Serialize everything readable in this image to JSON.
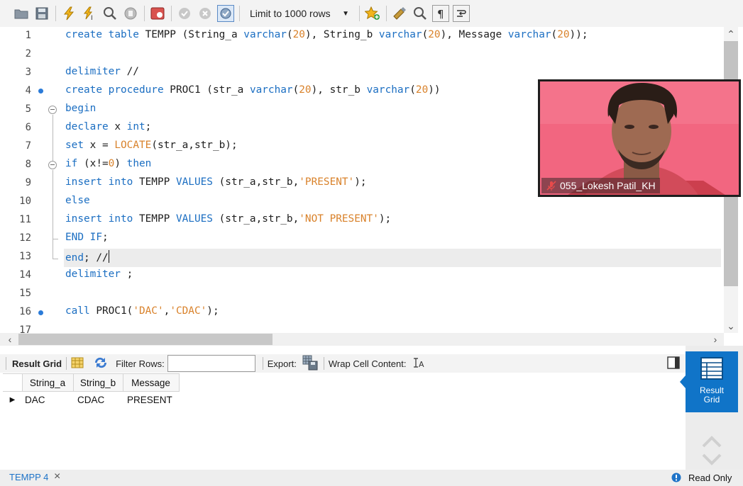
{
  "toolbar": {
    "limit_label": "Limit to 1000 rows",
    "icons": [
      "open-folder-icon",
      "save-icon",
      "execute-icon",
      "execute-cursor-icon",
      "explain-icon",
      "stop-icon",
      "toggle-error-icon",
      "commit-icon",
      "rollback-icon",
      "autocommit-icon",
      "add-snippet-icon",
      "beautify-icon",
      "find-icon",
      "invisible-chars-icon",
      "wrap-lines-icon"
    ]
  },
  "editor": {
    "line_numbers": [
      "1",
      "2",
      "3",
      "4",
      "5",
      "6",
      "7",
      "8",
      "9",
      "10",
      "11",
      "12",
      "13",
      "14",
      "15",
      "16",
      "17"
    ],
    "lines": [
      "create table TEMPP (String_a varchar(20), String_b varchar(20), Message varchar(20));",
      "",
      "delimiter //",
      "create procedure PROC1 (str_a varchar(20), str_b varchar(20))",
      "begin",
      "declare x int;",
      "set x = LOCATE(str_a,str_b);",
      "if (x!=0) then",
      "insert into TEMPP VALUES (str_a,str_b,'PRESENT');",
      "else",
      "insert into TEMPP VALUES (str_a,str_b,'NOT PRESENT');",
      "END IF;",
      "end; //",
      "delimiter ;",
      "",
      "call PROC1('DAC','CDAC');"
    ]
  },
  "webcam": {
    "participant_name": "055_Lokesh Patil_KH"
  },
  "results": {
    "tab_label": "Result Grid",
    "filter_label": "Filter Rows:",
    "filter_value": "",
    "export_label": "Export:",
    "wrap_label": "Wrap Cell Content:",
    "columns": [
      "String_a",
      "String_b",
      "Message"
    ],
    "rows": [
      [
        "DAC",
        "CDAC",
        "PRESENT"
      ]
    ]
  },
  "side_panel": {
    "active_label_1": "Result",
    "active_label_2": "Grid"
  },
  "status": {
    "tab_name": "TEMPP 4",
    "close_glyph": "×",
    "read_only": "Read Only"
  },
  "colors": {
    "keyword": "#1b6ec2",
    "literal": "#d9822b",
    "accent": "#1074c8"
  }
}
